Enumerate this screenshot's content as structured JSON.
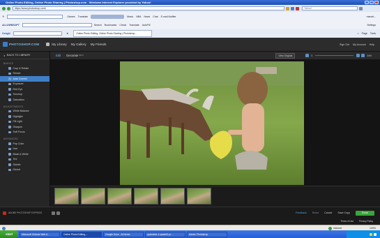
{
  "browser": {
    "title": "Online Photo Editing, Online Photo Sharing | Photoshop.com - Windows Internet Explorer provided by Yahoo!",
    "url": "https://www.photoshop.com/",
    "search_placeholder": "Yahoo!",
    "links_label": "Links",
    "tab_label": "Online Photo Editing, Online Photo Sharing | Photoshop...",
    "toolbar1": [
      "Y!",
      "Games",
      "Translate",
      "Music",
      "NBA",
      "News",
      "Chat",
      "E-mail Notifier"
    ],
    "toolbar1_user": "marcel...",
    "toolbar2_brand": "ALLOWBSOFT",
    "toolbar2_items": [
      "Search",
      "Bookmarks",
      "Check",
      "Translate",
      "AutoFill"
    ],
    "toolbar2_settings": "Settings",
    "google": "Google",
    "command_items": [
      "Page",
      "Tools"
    ]
  },
  "app": {
    "logo": "PHOTOSHOP.COM",
    "nav": [
      "My Library",
      "My Gallery",
      "My Friends"
    ],
    "header_right": [
      "Sign Out",
      "My Account",
      "Help"
    ],
    "back_label": "BACK TO LIBRARY",
    "sections": [
      {
        "title": "BASICS",
        "tools": [
          "Crop & Rotate",
          "Resize",
          "Auto Correct",
          "Exposure",
          "Red Eye",
          "Touchup",
          "Saturation"
        ],
        "active": 2
      },
      {
        "title": "ADJUSTMENTS",
        "tools": [
          "White Balance",
          "Highlight",
          "Fill Light",
          "Sharpen",
          "Soft Focus"
        ]
      },
      {
        "title": "ADVANCED",
        "tools": [
          "Pop Color",
          "Hue",
          "Black & White",
          "Tint",
          "Sketch",
          "Distort"
        ]
      }
    ],
    "tabs": [
      "Edit",
      "Decorate"
    ],
    "decorate_badge": "BETA",
    "view_original": "View Original",
    "zoom_value": "0",
    "zoom_percent": "34%",
    "thumbnail_count": 6,
    "footer_left": "ADOBE PHOTOSHOP EXPRESS",
    "feedback": "Feedback",
    "reset": "Reset",
    "cancel": "Cancel",
    "save_copy": "Save Copy",
    "done": "Done",
    "terms": "Terms of Use",
    "privacy": "Privacy Policy"
  },
  "status": {
    "zone": "Internet",
    "zoom": "100%"
  },
  "taskbar": {
    "start": "start",
    "tasks": [
      "Microsoft Outlook Web A...",
      "Online Photo Editing,...",
      "Google Docs - All items",
      "quicktime-4 splashfl-pr...",
      "Adobe Photoshop"
    ],
    "active_task": 1
  },
  "colors": {
    "accent": "#3f7fc7",
    "done_green": "#3aa53a",
    "link_blue": "#4fa3e6"
  }
}
